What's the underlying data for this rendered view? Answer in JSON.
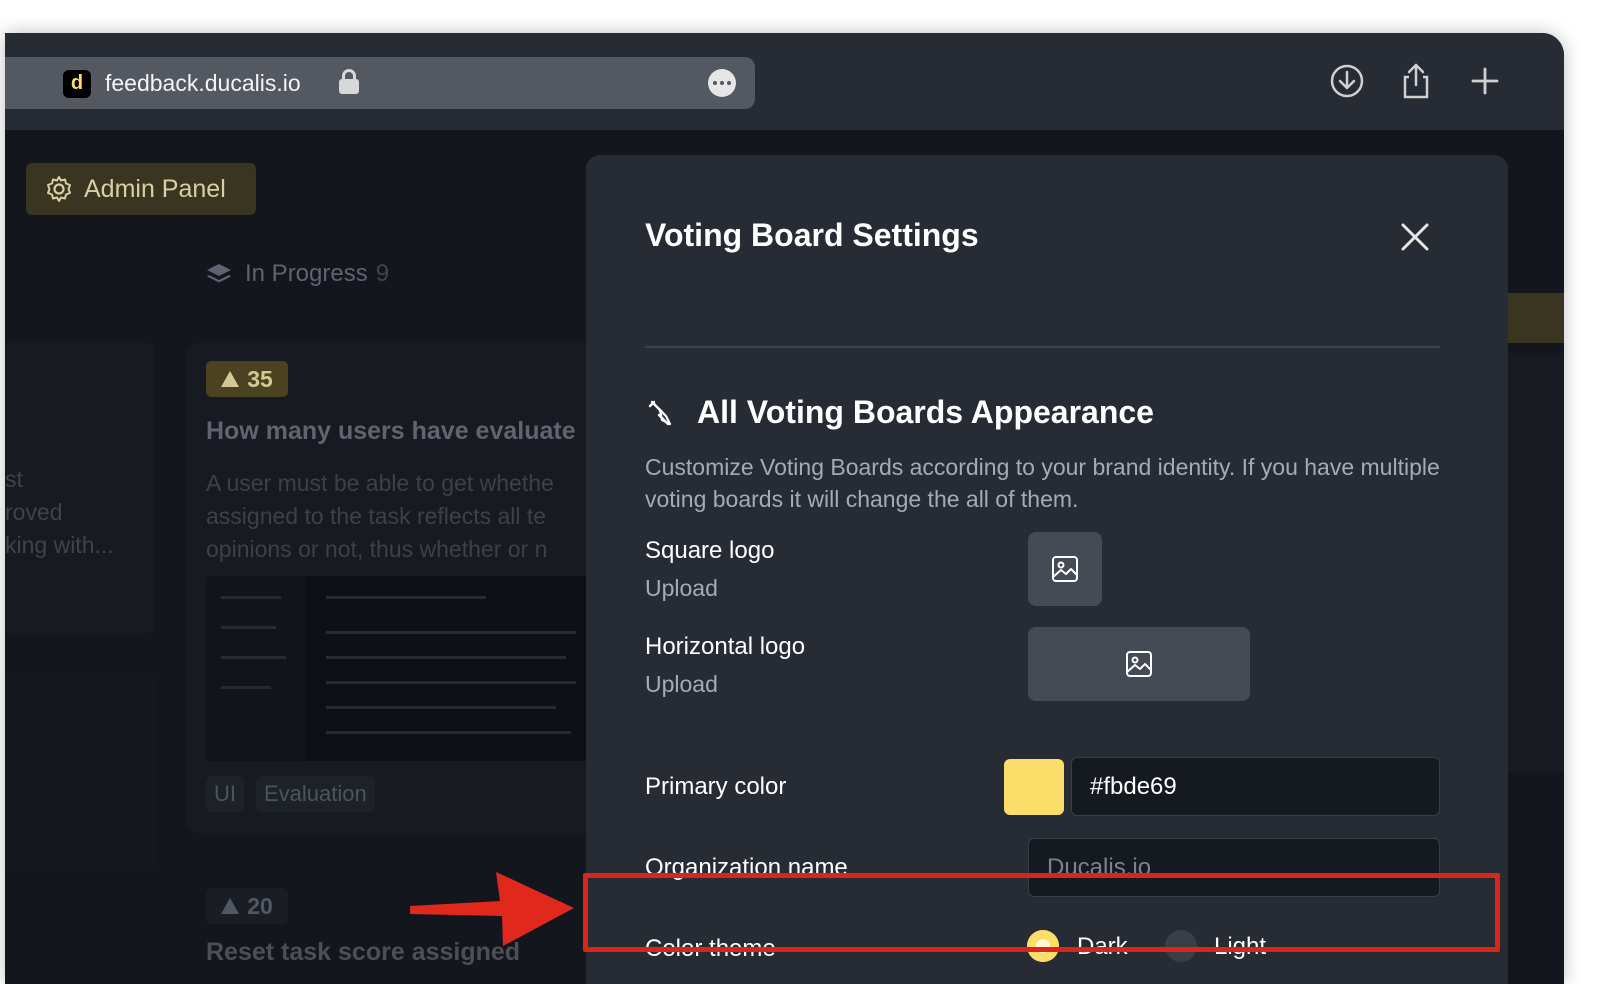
{
  "browser": {
    "favicon_letter": "d",
    "url": "feedback.ducalis.io"
  },
  "board": {
    "admin_button": "Admin Panel",
    "column": {
      "title": "In Progress",
      "count": "9"
    },
    "left_snippet": [
      "st",
      "roved",
      "king with..."
    ],
    "cards": [
      {
        "votes": "35",
        "title": "How many users have evaluate",
        "description": [
          "A user must be able to get whethe",
          "assigned to the task reflects all te",
          "opinions or not, thus whether or n"
        ],
        "tags": [
          "UI",
          "Evaluation"
        ]
      },
      {
        "votes": "20",
        "title": "Reset task score assigned"
      }
    ]
  },
  "modal": {
    "title": "Voting Board Settings",
    "section": {
      "title": "All Voting Boards Appearance",
      "description": "Customize Voting Boards according to your brand identity. If you have multiple voting boards it will change the all of them."
    },
    "square_logo": {
      "label": "Square logo",
      "action": "Upload"
    },
    "horizontal_logo": {
      "label": "Horizontal logo",
      "action": "Upload"
    },
    "primary_color": {
      "label": "Primary color",
      "value": "#fbde69"
    },
    "organization_name": {
      "label": "Organization name",
      "placeholder": "Ducalis.io"
    },
    "color_theme": {
      "label": "Color theme",
      "options": [
        {
          "label": "Dark",
          "selected": true
        },
        {
          "label": "Light",
          "selected": false
        }
      ]
    }
  },
  "colors": {
    "accent": "#fbde69",
    "highlight": "#d9261c",
    "modal_bg": "#272c34"
  }
}
